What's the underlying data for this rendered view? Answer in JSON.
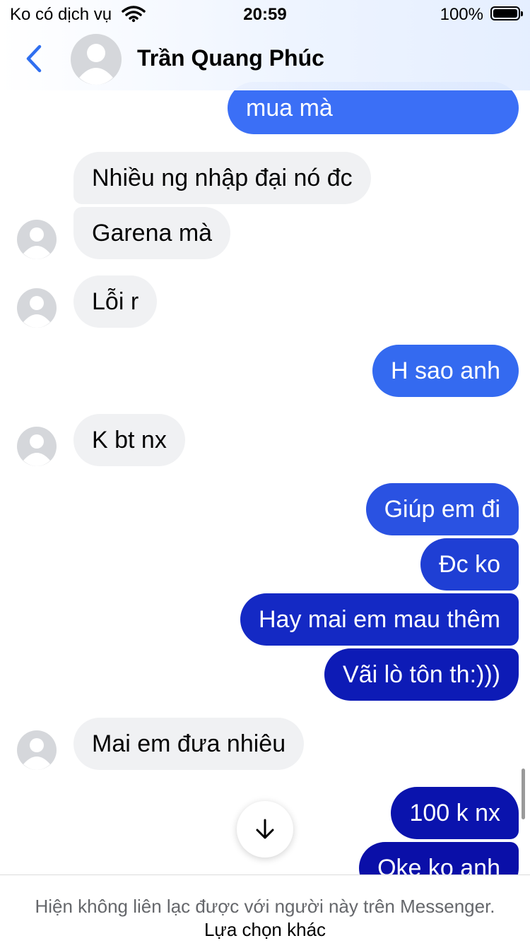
{
  "status_bar": {
    "carrier": "Ko có dịch vụ",
    "time": "20:59",
    "battery": "100%"
  },
  "header": {
    "contact_name": "Trần Quang Phúc",
    "back_icon": "chevron-left-icon",
    "avatar_icon": "default-avatar-icon"
  },
  "messages": [
    {
      "side": "out",
      "text": "mua mà"
    },
    {
      "side": "in",
      "text": "Nhiều ng nhập đại nó đc"
    },
    {
      "side": "in",
      "text": "Garena mà"
    },
    {
      "side": "in",
      "text": "Lỗi r"
    },
    {
      "side": "out",
      "text": "H sao anh"
    },
    {
      "side": "in",
      "text": "K bt nx"
    },
    {
      "side": "out",
      "text": "Giúp em đi"
    },
    {
      "side": "out",
      "text": "Đc ko"
    },
    {
      "side": "out",
      "text": "Hay mai em mau thêm"
    },
    {
      "side": "out",
      "text": "Vãi lò tôn th:)))"
    },
    {
      "side": "in",
      "text": "Mai em đưa nhiêu"
    },
    {
      "side": "out",
      "text": "100 k nx"
    },
    {
      "side": "out",
      "text": "Oke ko anh"
    }
  ],
  "scroll_down_icon": "arrow-down-icon",
  "footer": {
    "text": "Hiện không liên lạc được với người này trên Messenger.",
    "link": "Lựa chọn khác"
  },
  "colors": {
    "outgoing_top": "#3b6ff6",
    "outgoing_bottom": "#0a0fa8",
    "incoming": "#f0f1f3",
    "accent": "#2f6ff0"
  }
}
